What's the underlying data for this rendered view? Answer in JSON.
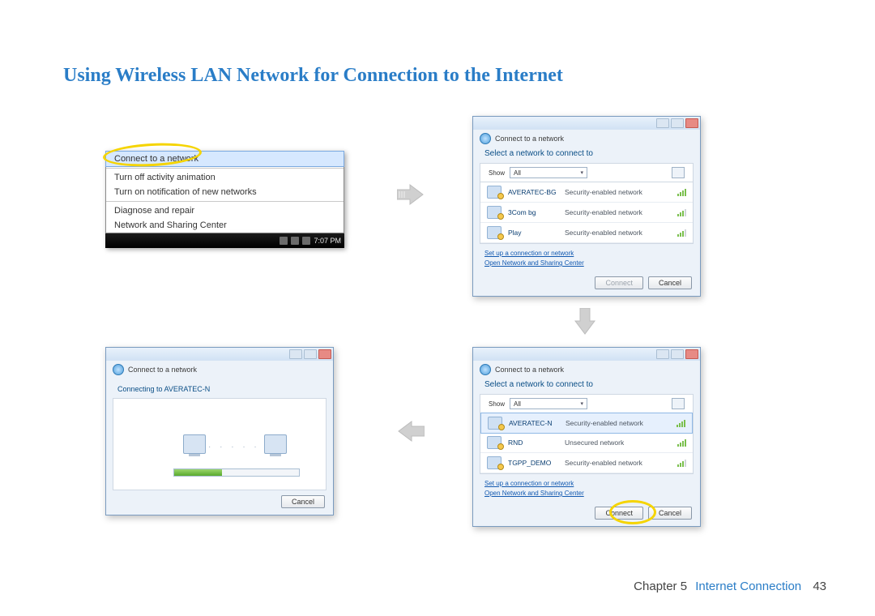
{
  "page": {
    "title": "Using Wireless LAN Network for Connection to the Internet",
    "footer_chapter": "Chapter 5",
    "footer_section": "Internet Connection",
    "footer_page": "43"
  },
  "panel1": {
    "menu_items": {
      "connect": "Connect to a network",
      "turn_off_anim": "Turn off activity animation",
      "turn_on_notif": "Turn on notification of new networks",
      "diagnose": "Diagnose and repair",
      "network_center": "Network and Sharing Center"
    },
    "clock": "7:07 PM"
  },
  "panel2": {
    "breadcrumb": "Connect to a network",
    "instruction": "Select a network to connect to",
    "show_label": "Show",
    "show_value": "All",
    "networks": [
      {
        "name": "AVERATEC-BG",
        "desc": "Security-enabled network"
      },
      {
        "name": "3Com bg",
        "desc": "Security-enabled network"
      },
      {
        "name": "Play",
        "desc": "Security-enabled network"
      }
    ],
    "link_setup": "Set up a connection or network",
    "link_center": "Open Network and Sharing Center",
    "btn_connect": "Connect",
    "btn_cancel": "Cancel"
  },
  "panel3": {
    "breadcrumb": "Connect to a network",
    "instruction": "Select a network to connect to",
    "show_label": "Show",
    "show_value": "All",
    "networks": [
      {
        "name": "AVERATEC-N",
        "desc": "Security-enabled network"
      },
      {
        "name": "RND",
        "desc": "Unsecured network"
      },
      {
        "name": "TGPP_DEMO",
        "desc": "Security-enabled network"
      }
    ],
    "link_setup": "Set up a connection or network",
    "link_center": "Open Network and Sharing Center",
    "btn_connect": "Connect",
    "btn_cancel": "Cancel"
  },
  "panel4": {
    "breadcrumb": "Connect to a network",
    "status": "Connecting to AVERATEC-N",
    "btn_cancel": "Cancel"
  }
}
